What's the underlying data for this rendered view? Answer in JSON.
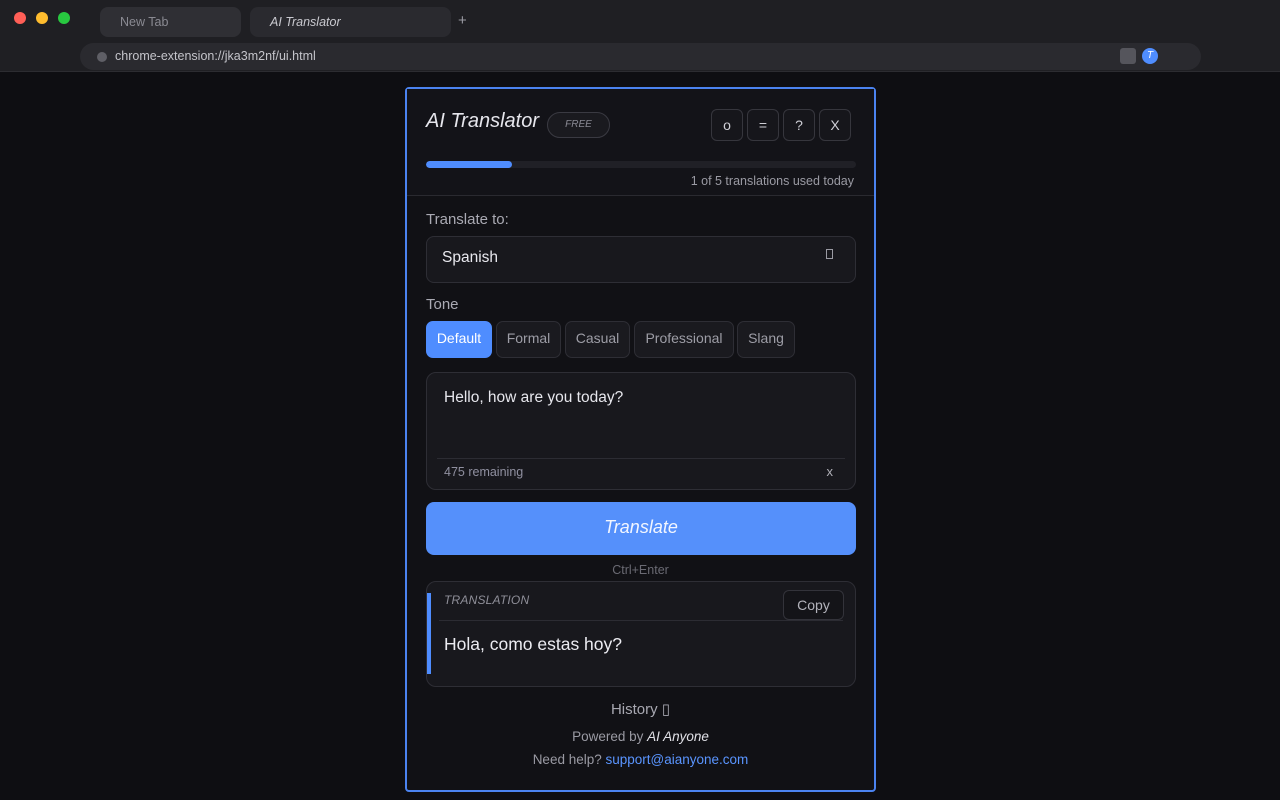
{
  "browser": {
    "tabs": [
      {
        "label": "New Tab"
      },
      {
        "label": "AI Translator"
      }
    ],
    "new_tab_label": "+",
    "url": "chrome-extension://jka3m2nf/ui.html",
    "extension_avatar_letter": "T"
  },
  "header": {
    "title": "AI Translator",
    "badge": "FREE",
    "buttons": [
      "o",
      "=",
      "?",
      "X"
    ],
    "usage_fraction": 0.2,
    "usage_text": "1 of 5 translations used today"
  },
  "language": {
    "label": "Translate to:",
    "selected": "Spanish",
    "chevron_glyph": "▯"
  },
  "tone": {
    "label": "Tone",
    "options": [
      "Default",
      "Formal",
      "Casual",
      "Professional",
      "Slang"
    ],
    "selected": "Default"
  },
  "input": {
    "text": "Hello, how are you today?",
    "remaining": "475 remaining",
    "clear_label": "x"
  },
  "translate_button": "Translate",
  "shortcut": "Ctrl+Enter",
  "result": {
    "label": "TRANSLATION",
    "copy_label": "Copy",
    "text": "Hola, como estas hoy?"
  },
  "footer": {
    "history": "History ▯",
    "powered_prefix": "Powered by",
    "powered_brand": "AI Anyone",
    "help_prefix": "Need help?",
    "help_email": "support@aianyone.com"
  },
  "colors": {
    "accent": "#4f8dff",
    "background": "#0e0e12"
  }
}
